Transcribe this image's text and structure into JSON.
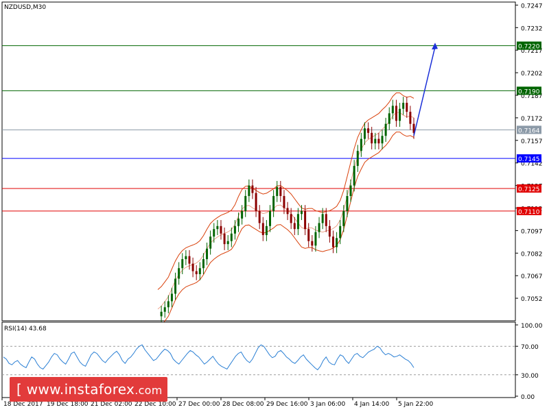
{
  "chart_data": [
    {
      "type": "candlestick",
      "title": "NZDUSD,M30",
      "y_ticks": [
        "0.7247",
        "0.7232",
        "0.7217",
        "0.7202",
        "0.7187",
        "0.7172",
        "0.7157",
        "0.7142",
        "0.7127",
        "0.7112",
        "0.7097",
        "0.7082",
        "0.7067",
        "0.7052"
      ],
      "ylim": [
        0.7037,
        0.7249
      ],
      "x_ticks": [
        "18 Dec 2017",
        "19 Dec 18:00",
        "21 Dec 02:00",
        "22 Dec 10:00",
        "27 Dec 00:00",
        "28 Dec 08:00",
        "29 Dec 16:00",
        "3 Jan 06:00",
        "4 Jan 14:00",
        "5 Jan 22:00"
      ],
      "levels": [
        {
          "value": 0.722,
          "label": "0.7220",
          "color": "#006400",
          "label_bg": "#006400"
        },
        {
          "value": 0.719,
          "label": "0.7190",
          "color": "#006400",
          "label_bg": "#006400"
        },
        {
          "value": 0.7164,
          "label": "0.7164",
          "color": "#8c9aa8",
          "label_bg": "#8c9aa8"
        },
        {
          "value": 0.7145,
          "label": "0.7145",
          "color": "#0000ff",
          "label_bg": "#0000ff"
        },
        {
          "value": 0.7125,
          "label": "0.7125",
          "color": "#e00000",
          "label_bg": "#e00000"
        },
        {
          "value": 0.711,
          "label": "0.7110",
          "color": "#e00000",
          "label_bg": "#e00000"
        }
      ],
      "series": [
        {
          "name": "price",
          "color_up": "#006400",
          "color_down": "#8b0000",
          "y": [
            0.704,
            0.7043,
            0.7046,
            0.705,
            0.7055,
            0.7065,
            0.7072,
            0.7078,
            0.708,
            0.7075,
            0.707,
            0.7068,
            0.7072,
            0.7078,
            0.7085,
            0.7093,
            0.7098,
            0.71,
            0.7095,
            0.7088,
            0.709,
            0.7095,
            0.71,
            0.7105,
            0.711,
            0.712,
            0.7127,
            0.7122,
            0.711,
            0.7102,
            0.7094,
            0.71,
            0.711,
            0.712,
            0.7126,
            0.712,
            0.7112,
            0.7108,
            0.7102,
            0.7098,
            0.7108,
            0.711,
            0.7098,
            0.709,
            0.7087,
            0.7096,
            0.7102,
            0.7108,
            0.71,
            0.7093,
            0.7086,
            0.7092,
            0.71,
            0.711,
            0.712,
            0.7127,
            0.714,
            0.715,
            0.7158,
            0.7165,
            0.7162,
            0.7155,
            0.7158,
            0.7155,
            0.716,
            0.7168,
            0.7175,
            0.718,
            0.717,
            0.7178,
            0.7182,
            0.7176,
            0.7168,
            0.7162
          ]
        },
        {
          "name": "bands",
          "color": "#d9400a"
        }
      ],
      "annotation": {
        "type": "arrow",
        "from": [
          0.716,
          "5 Jan 22:00"
        ],
        "to": 0.7222,
        "color": "#1a2fd8"
      }
    },
    {
      "type": "line",
      "title": "RSI(14) 43.68",
      "y_ticks": [
        "100.00",
        "70.00",
        "30.00",
        "0.00"
      ],
      "ylim": [
        0,
        100
      ],
      "levels": [
        70,
        30
      ],
      "series": [
        {
          "name": "RSI(14)",
          "color": "#2a7fd4",
          "y": [
            55,
            52,
            46,
            44,
            48,
            50,
            45,
            42,
            40,
            48,
            55,
            52,
            45,
            40,
            38,
            43,
            48,
            55,
            60,
            58,
            52,
            48,
            45,
            52,
            60,
            62,
            55,
            48,
            44,
            42,
            50,
            58,
            62,
            60,
            55,
            50,
            47,
            52,
            56,
            60,
            63,
            58,
            50,
            46,
            52,
            55,
            60,
            66,
            70,
            72,
            65,
            60,
            55,
            50,
            52,
            57,
            62,
            66,
            64,
            60,
            52,
            48,
            45,
            50,
            55,
            60,
            64,
            62,
            58,
            55,
            50,
            45,
            48,
            52,
            56,
            50,
            45,
            42,
            40,
            38,
            44,
            50,
            56,
            60,
            62,
            55,
            50,
            47,
            52,
            60,
            68,
            72,
            70,
            64,
            58,
            54,
            56,
            62,
            64,
            60,
            55,
            52,
            48,
            46,
            50,
            55,
            58,
            52,
            48,
            44,
            40,
            37,
            42,
            50,
            55,
            48,
            45,
            44,
            52,
            58,
            56,
            50,
            46,
            52,
            58,
            60,
            56,
            54,
            58,
            62,
            64,
            66,
            70,
            68,
            62,
            58,
            60,
            58,
            55,
            56,
            58,
            55,
            52,
            50,
            46,
            40
          ]
        }
      ]
    }
  ],
  "watermark": {
    "text": "[ www.instaforex.com ]",
    "bracket_open": "[",
    "site": "www.instaforex",
    "tld": ".com",
    "bracket_close": "]"
  }
}
